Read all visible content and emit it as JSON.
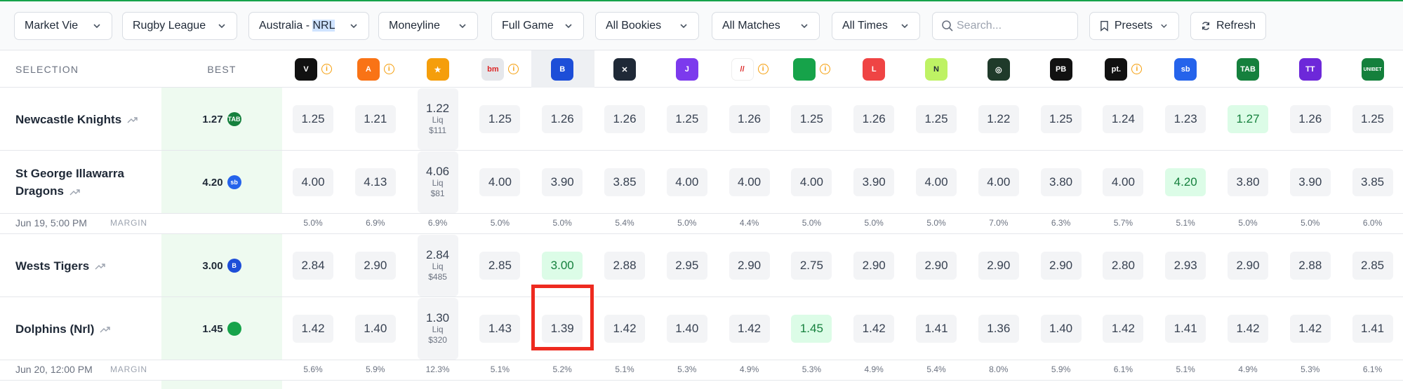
{
  "toolbar": {
    "market_view": "Market Vie",
    "sport": "Rugby League",
    "league_prefix": "Australia - ",
    "league_highlight": "NRL",
    "market": "Moneyline",
    "period": "Full Game",
    "bookies": "All Bookies",
    "matches": "All Matches",
    "times": "All Times",
    "search_placeholder": "Search...",
    "presets": "Presets",
    "refresh": "Refresh"
  },
  "table": {
    "selection_header": "SELECTION",
    "best_header": "BEST",
    "bookmakers": [
      {
        "icon": "vertical-logo-icon",
        "short": "V",
        "color": "#111111",
        "info": true
      },
      {
        "icon": "flame-logo-icon",
        "short": "A",
        "color": "#f97316",
        "info": true
      },
      {
        "icon": "ticket-logo-icon",
        "short": "★",
        "color": "#f59e0b",
        "info": false
      },
      {
        "icon": "circle-logo-icon",
        "short": "bm",
        "color": "#e5e7eb",
        "info": true
      },
      {
        "icon": "b-logo-icon",
        "short": "B",
        "color": "#1d4ed8",
        "info": false
      },
      {
        "icon": "x-logo-icon",
        "short": "✕",
        "color": "#1f2937",
        "info": false
      },
      {
        "icon": "j-logo-icon",
        "short": "J",
        "color": "#7c3aed",
        "info": false
      },
      {
        "icon": "slash-logo-icon",
        "short": "//",
        "color": "#ffffff",
        "info": true
      },
      {
        "icon": "green-square-logo-icon",
        "short": "",
        "color": "#16a34a",
        "info": true
      },
      {
        "icon": "l-logo-icon",
        "short": "L",
        "color": "#ef4444",
        "info": false
      },
      {
        "icon": "n-logo-icon",
        "short": "N",
        "color": "#bef264",
        "info": false
      },
      {
        "icon": "shield-logo-icon",
        "short": "◎",
        "color": "#1f3a2a",
        "info": false
      },
      {
        "icon": "pb-logo-icon",
        "short": "PB",
        "color": "#111111",
        "info": false
      },
      {
        "icon": "pt-logo-icon",
        "short": "pt.",
        "color": "#111111",
        "info": true
      },
      {
        "icon": "sportsbet-logo-icon",
        "short": "sb",
        "color": "#2563eb",
        "info": false
      },
      {
        "icon": "tab-logo-icon",
        "short": "TAB",
        "color": "#15803d",
        "info": false
      },
      {
        "icon": "tab-touch-logo-icon",
        "short": "TT",
        "color": "#6d28d9",
        "info": false
      },
      {
        "icon": "unibet-logo-icon",
        "short": "UNIBET",
        "color": "#14803c",
        "info": false
      }
    ],
    "rows": [
      {
        "team": "Newcastle Knights",
        "best": "1.27",
        "best_logo_color": "#15803d",
        "best_logo_text": "TAB",
        "odds": [
          "1.25",
          "1.21",
          "1.22",
          "1.25",
          "1.26",
          "1.26",
          "1.25",
          "1.26",
          "1.25",
          "1.26",
          "1.25",
          "1.22",
          "1.25",
          "1.24",
          "1.23",
          "1.27",
          "1.26",
          "1.25"
        ],
        "liq": "$111",
        "best_index": 15
      },
      {
        "team": "St George Illawarra Dragons",
        "best": "4.20",
        "best_logo_color": "#2563eb",
        "best_logo_text": "sb",
        "odds": [
          "4.00",
          "4.13",
          "4.06",
          "4.00",
          "3.90",
          "3.85",
          "4.00",
          "4.00",
          "4.00",
          "3.90",
          "4.00",
          "4.00",
          "3.80",
          "4.00",
          "4.20",
          "3.80",
          "3.90",
          "3.85"
        ],
        "liq": "$81",
        "best_index": 14
      },
      {
        "team": "Wests Tigers",
        "best": "3.00",
        "best_logo_color": "#1d4ed8",
        "best_logo_text": "B",
        "odds": [
          "2.84",
          "2.90",
          "2.84",
          "2.85",
          "3.00",
          "2.88",
          "2.95",
          "2.90",
          "2.75",
          "2.90",
          "2.90",
          "2.90",
          "2.90",
          "2.80",
          "2.93",
          "2.90",
          "2.88",
          "2.85"
        ],
        "liq": "$485",
        "best_index": 4
      },
      {
        "team": "Dolphins (Nrl)",
        "best": "1.45",
        "best_logo_color": "#16a34a",
        "best_logo_text": "",
        "odds": [
          "1.42",
          "1.40",
          "1.30",
          "1.43",
          "1.39",
          "1.42",
          "1.40",
          "1.42",
          "1.45",
          "1.42",
          "1.41",
          "1.36",
          "1.40",
          "1.42",
          "1.41",
          "1.42",
          "1.42",
          "1.41"
        ],
        "liq": "$320",
        "best_index": 8
      }
    ],
    "liq_label": "Liq",
    "margins": [
      {
        "time": "Jun 19, 5:00 PM",
        "label": "MARGIN",
        "values": [
          "5.0%",
          "6.9%",
          "6.9%",
          "5.0%",
          "5.0%",
          "5.4%",
          "5.0%",
          "4.4%",
          "5.0%",
          "5.0%",
          "5.0%",
          "7.0%",
          "6.3%",
          "5.7%",
          "5.1%",
          "5.0%",
          "5.0%",
          "6.0%"
        ]
      },
      {
        "time": "Jun 20, 12:00 PM",
        "label": "MARGIN",
        "values": [
          "5.6%",
          "5.9%",
          "12.3%",
          "5.1%",
          "5.2%",
          "5.1%",
          "5.3%",
          "4.9%",
          "5.3%",
          "4.9%",
          "5.4%",
          "8.0%",
          "5.9%",
          "6.1%",
          "5.1%",
          "4.9%",
          "5.3%",
          "6.1%"
        ]
      }
    ]
  }
}
